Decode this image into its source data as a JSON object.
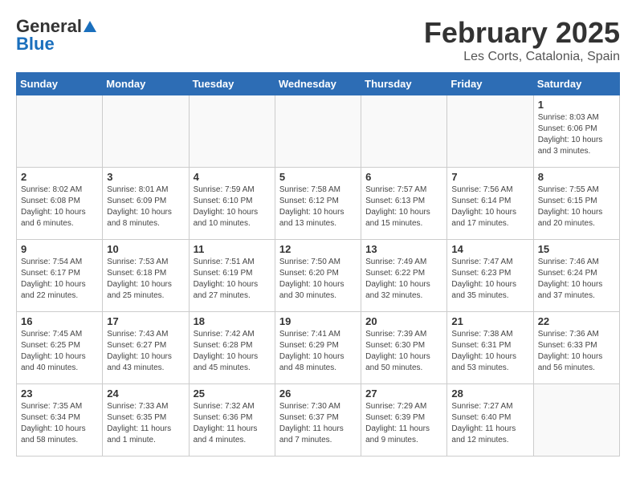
{
  "header": {
    "logo_general": "General",
    "logo_blue": "Blue",
    "month": "February 2025",
    "location": "Les Corts, Catalonia, Spain"
  },
  "weekdays": [
    "Sunday",
    "Monday",
    "Tuesday",
    "Wednesday",
    "Thursday",
    "Friday",
    "Saturday"
  ],
  "weeks": [
    [
      {
        "day": "",
        "info": ""
      },
      {
        "day": "",
        "info": ""
      },
      {
        "day": "",
        "info": ""
      },
      {
        "day": "",
        "info": ""
      },
      {
        "day": "",
        "info": ""
      },
      {
        "day": "",
        "info": ""
      },
      {
        "day": "1",
        "info": "Sunrise: 8:03 AM\nSunset: 6:06 PM\nDaylight: 10 hours\nand 3 minutes."
      }
    ],
    [
      {
        "day": "2",
        "info": "Sunrise: 8:02 AM\nSunset: 6:08 PM\nDaylight: 10 hours\nand 6 minutes."
      },
      {
        "day": "3",
        "info": "Sunrise: 8:01 AM\nSunset: 6:09 PM\nDaylight: 10 hours\nand 8 minutes."
      },
      {
        "day": "4",
        "info": "Sunrise: 7:59 AM\nSunset: 6:10 PM\nDaylight: 10 hours\nand 10 minutes."
      },
      {
        "day": "5",
        "info": "Sunrise: 7:58 AM\nSunset: 6:12 PM\nDaylight: 10 hours\nand 13 minutes."
      },
      {
        "day": "6",
        "info": "Sunrise: 7:57 AM\nSunset: 6:13 PM\nDaylight: 10 hours\nand 15 minutes."
      },
      {
        "day": "7",
        "info": "Sunrise: 7:56 AM\nSunset: 6:14 PM\nDaylight: 10 hours\nand 17 minutes."
      },
      {
        "day": "8",
        "info": "Sunrise: 7:55 AM\nSunset: 6:15 PM\nDaylight: 10 hours\nand 20 minutes."
      }
    ],
    [
      {
        "day": "9",
        "info": "Sunrise: 7:54 AM\nSunset: 6:17 PM\nDaylight: 10 hours\nand 22 minutes."
      },
      {
        "day": "10",
        "info": "Sunrise: 7:53 AM\nSunset: 6:18 PM\nDaylight: 10 hours\nand 25 minutes."
      },
      {
        "day": "11",
        "info": "Sunrise: 7:51 AM\nSunset: 6:19 PM\nDaylight: 10 hours\nand 27 minutes."
      },
      {
        "day": "12",
        "info": "Sunrise: 7:50 AM\nSunset: 6:20 PM\nDaylight: 10 hours\nand 30 minutes."
      },
      {
        "day": "13",
        "info": "Sunrise: 7:49 AM\nSunset: 6:22 PM\nDaylight: 10 hours\nand 32 minutes."
      },
      {
        "day": "14",
        "info": "Sunrise: 7:47 AM\nSunset: 6:23 PM\nDaylight: 10 hours\nand 35 minutes."
      },
      {
        "day": "15",
        "info": "Sunrise: 7:46 AM\nSunset: 6:24 PM\nDaylight: 10 hours\nand 37 minutes."
      }
    ],
    [
      {
        "day": "16",
        "info": "Sunrise: 7:45 AM\nSunset: 6:25 PM\nDaylight: 10 hours\nand 40 minutes."
      },
      {
        "day": "17",
        "info": "Sunrise: 7:43 AM\nSunset: 6:27 PM\nDaylight: 10 hours\nand 43 minutes."
      },
      {
        "day": "18",
        "info": "Sunrise: 7:42 AM\nSunset: 6:28 PM\nDaylight: 10 hours\nand 45 minutes."
      },
      {
        "day": "19",
        "info": "Sunrise: 7:41 AM\nSunset: 6:29 PM\nDaylight: 10 hours\nand 48 minutes."
      },
      {
        "day": "20",
        "info": "Sunrise: 7:39 AM\nSunset: 6:30 PM\nDaylight: 10 hours\nand 50 minutes."
      },
      {
        "day": "21",
        "info": "Sunrise: 7:38 AM\nSunset: 6:31 PM\nDaylight: 10 hours\nand 53 minutes."
      },
      {
        "day": "22",
        "info": "Sunrise: 7:36 AM\nSunset: 6:33 PM\nDaylight: 10 hours\nand 56 minutes."
      }
    ],
    [
      {
        "day": "23",
        "info": "Sunrise: 7:35 AM\nSunset: 6:34 PM\nDaylight: 10 hours\nand 58 minutes."
      },
      {
        "day": "24",
        "info": "Sunrise: 7:33 AM\nSunset: 6:35 PM\nDaylight: 11 hours\nand 1 minute."
      },
      {
        "day": "25",
        "info": "Sunrise: 7:32 AM\nSunset: 6:36 PM\nDaylight: 11 hours\nand 4 minutes."
      },
      {
        "day": "26",
        "info": "Sunrise: 7:30 AM\nSunset: 6:37 PM\nDaylight: 11 hours\nand 7 minutes."
      },
      {
        "day": "27",
        "info": "Sunrise: 7:29 AM\nSunset: 6:39 PM\nDaylight: 11 hours\nand 9 minutes."
      },
      {
        "day": "28",
        "info": "Sunrise: 7:27 AM\nSunset: 6:40 PM\nDaylight: 11 hours\nand 12 minutes."
      },
      {
        "day": "",
        "info": ""
      }
    ]
  ]
}
